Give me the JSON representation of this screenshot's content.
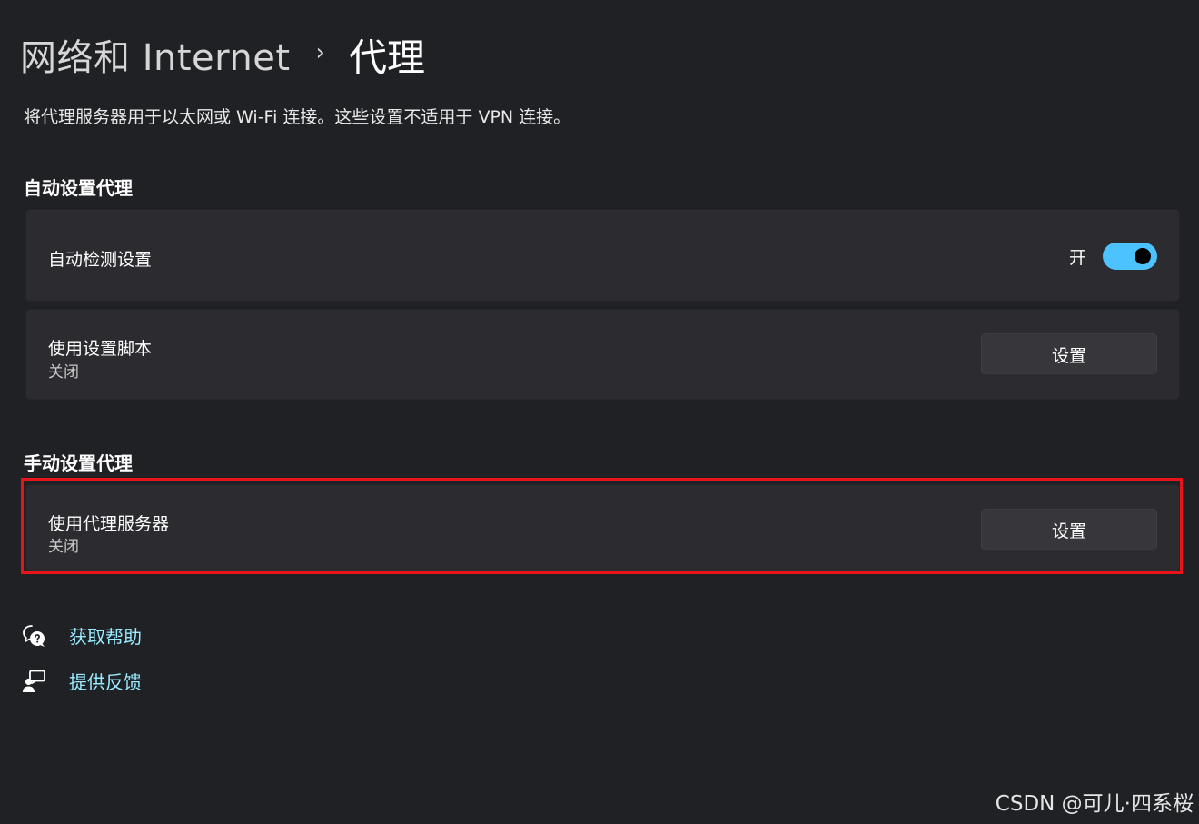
{
  "header": {
    "parent": "网络和 Internet",
    "separator": "›",
    "current": "代理"
  },
  "description": "将代理服务器用于以太网或 Wi-Fi 连接。这些设置不适用于 VPN 连接。",
  "auto_section": {
    "title": "自动设置代理",
    "auto_detect": {
      "label": "自动检测设置",
      "toggle_state_text": "开",
      "toggle_on": true
    },
    "setup_script": {
      "label": "使用设置脚本",
      "status": "关闭",
      "button_label": "设置"
    }
  },
  "manual_section": {
    "title": "手动设置代理",
    "proxy_server": {
      "label": "使用代理服务器",
      "status": "关闭",
      "button_label": "设置"
    }
  },
  "links": {
    "help": {
      "label": "获取帮助",
      "icon": "help-chat-icon"
    },
    "feedback": {
      "label": "提供反馈",
      "icon": "feedback-person-icon"
    }
  },
  "watermark": "CSDN @可儿·四系桜",
  "colors": {
    "background": "#202125",
    "card": "#2b2b30",
    "accent": "#4cc2ff",
    "link": "#99ebff",
    "highlight": "#e8141c"
  }
}
